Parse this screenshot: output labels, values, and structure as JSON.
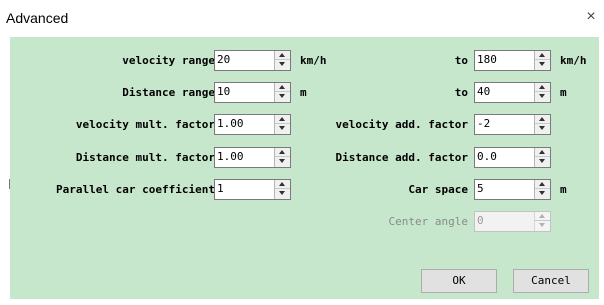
{
  "window": {
    "title": "Advanced",
    "close_glyph": "×"
  },
  "rows": {
    "velocity_range": {
      "label": "velocity range",
      "from": "20",
      "from_unit": "km/h",
      "to_label": "to",
      "to": "180",
      "to_unit": "km/h"
    },
    "distance_range": {
      "label": "Distance range",
      "from": "10",
      "from_unit": "m",
      "to_label": "to",
      "to": "40",
      "to_unit": "m"
    },
    "velocity_factors": {
      "mult_label": "velocity mult. factor",
      "mult": "1.00",
      "add_label": "velocity add. factor",
      "add": "-2"
    },
    "distance_factors": {
      "mult_label": "Distance mult. factor",
      "mult": "1.00",
      "add_label": "Distance add. factor",
      "add": "0.0"
    },
    "parallel": {
      "label": "Parallel car coefficient",
      "value": "1",
      "space_label": "Car space",
      "space": "5",
      "space_unit": "m"
    },
    "center_angle": {
      "label": "Center angle",
      "value": "0",
      "enabled": false
    }
  },
  "buttons": {
    "ok": "OK",
    "cancel": "Cancel"
  },
  "colors": {
    "client_bg": "#c7e7cc",
    "disabled_text": "#8a8a8a"
  }
}
